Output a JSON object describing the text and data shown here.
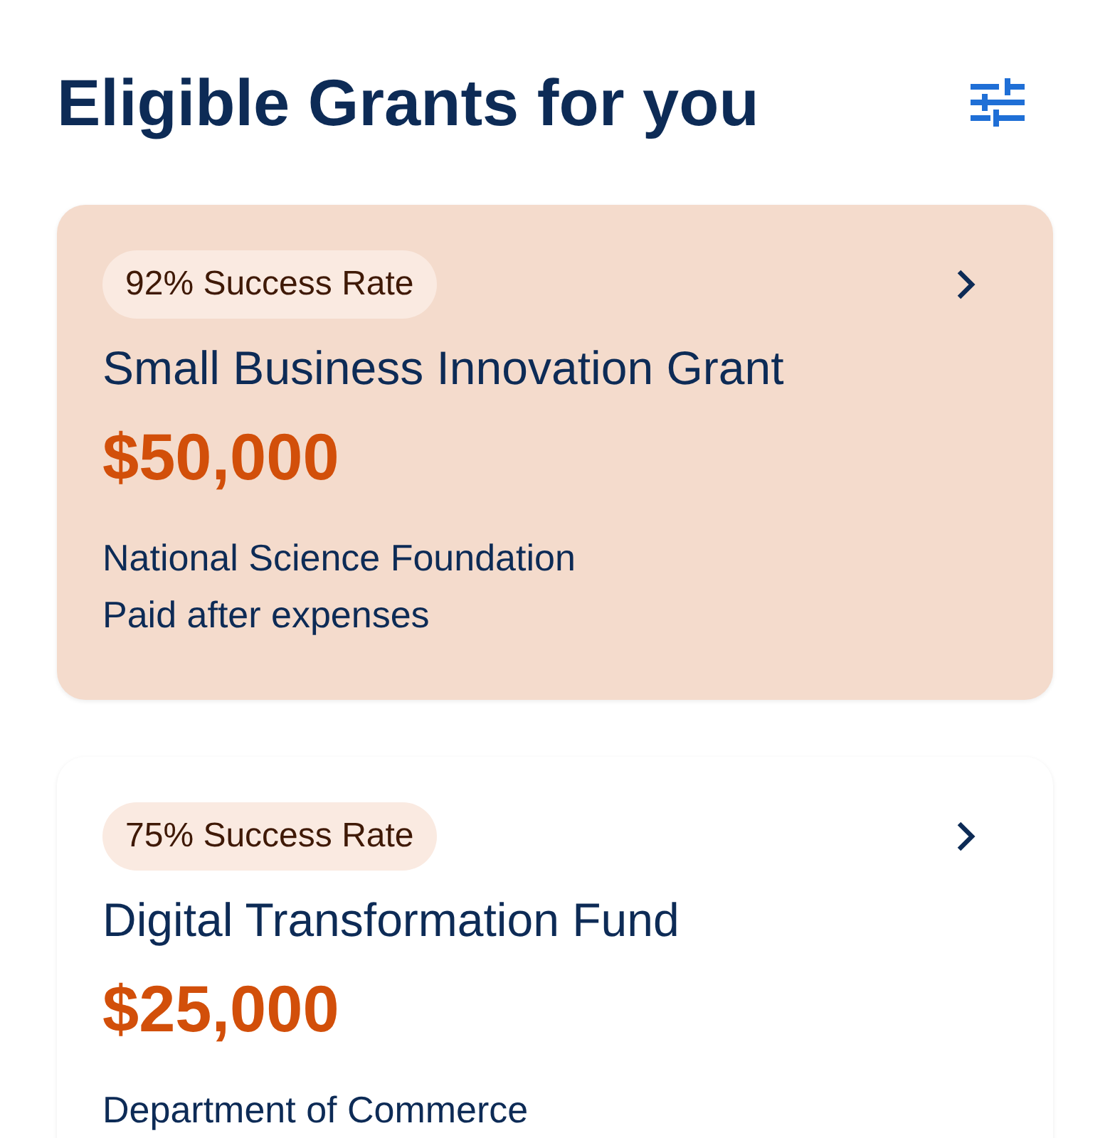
{
  "header": {
    "title": "Eligible Grants for you"
  },
  "grants": [
    {
      "success_rate": "92% Success Rate",
      "name": "Small Business Innovation Grant",
      "amount": "$50,000",
      "details": [
        "National Science Foundation",
        "Paid after expenses"
      ],
      "selected": true
    },
    {
      "success_rate": "75% Success Rate",
      "name": "Digital Transformation Fund",
      "amount": "$25,000",
      "details": [
        "Department of Commerce"
      ],
      "selected": false
    }
  ]
}
